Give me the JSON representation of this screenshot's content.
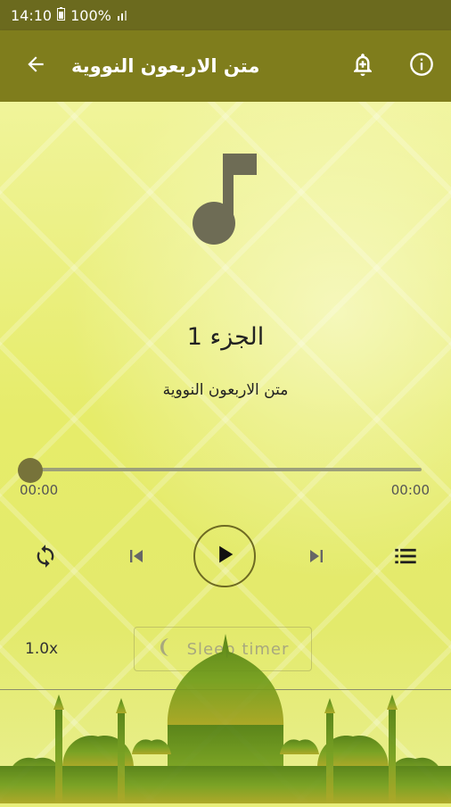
{
  "status_bar": {
    "time": "14:10",
    "battery": "100%",
    "icons": [
      "battery-saver-icon",
      "signal-icon"
    ]
  },
  "app_bar": {
    "title": "متن الاربعون النووية",
    "icons": [
      "back-arrow-icon",
      "bell-add-icon",
      "info-icon"
    ]
  },
  "player": {
    "track_title": "الجزء 1",
    "album": "متن الاربعون النووية",
    "elapsed": "00:00",
    "duration": "00:00",
    "progress": 0,
    "speed": "1.0x",
    "sleep_timer_label": "Sleep timer",
    "icons": [
      "music-note-icon",
      "repeat-icon",
      "skip-previous-icon",
      "play-icon",
      "skip-next-icon",
      "playlist-icon",
      "moon-icon"
    ]
  },
  "colors": {
    "status_bar": "#6b6a1e",
    "app_bar": "#7f7d1c",
    "accent": "#6e6a22",
    "background": "#e8ee7a"
  }
}
